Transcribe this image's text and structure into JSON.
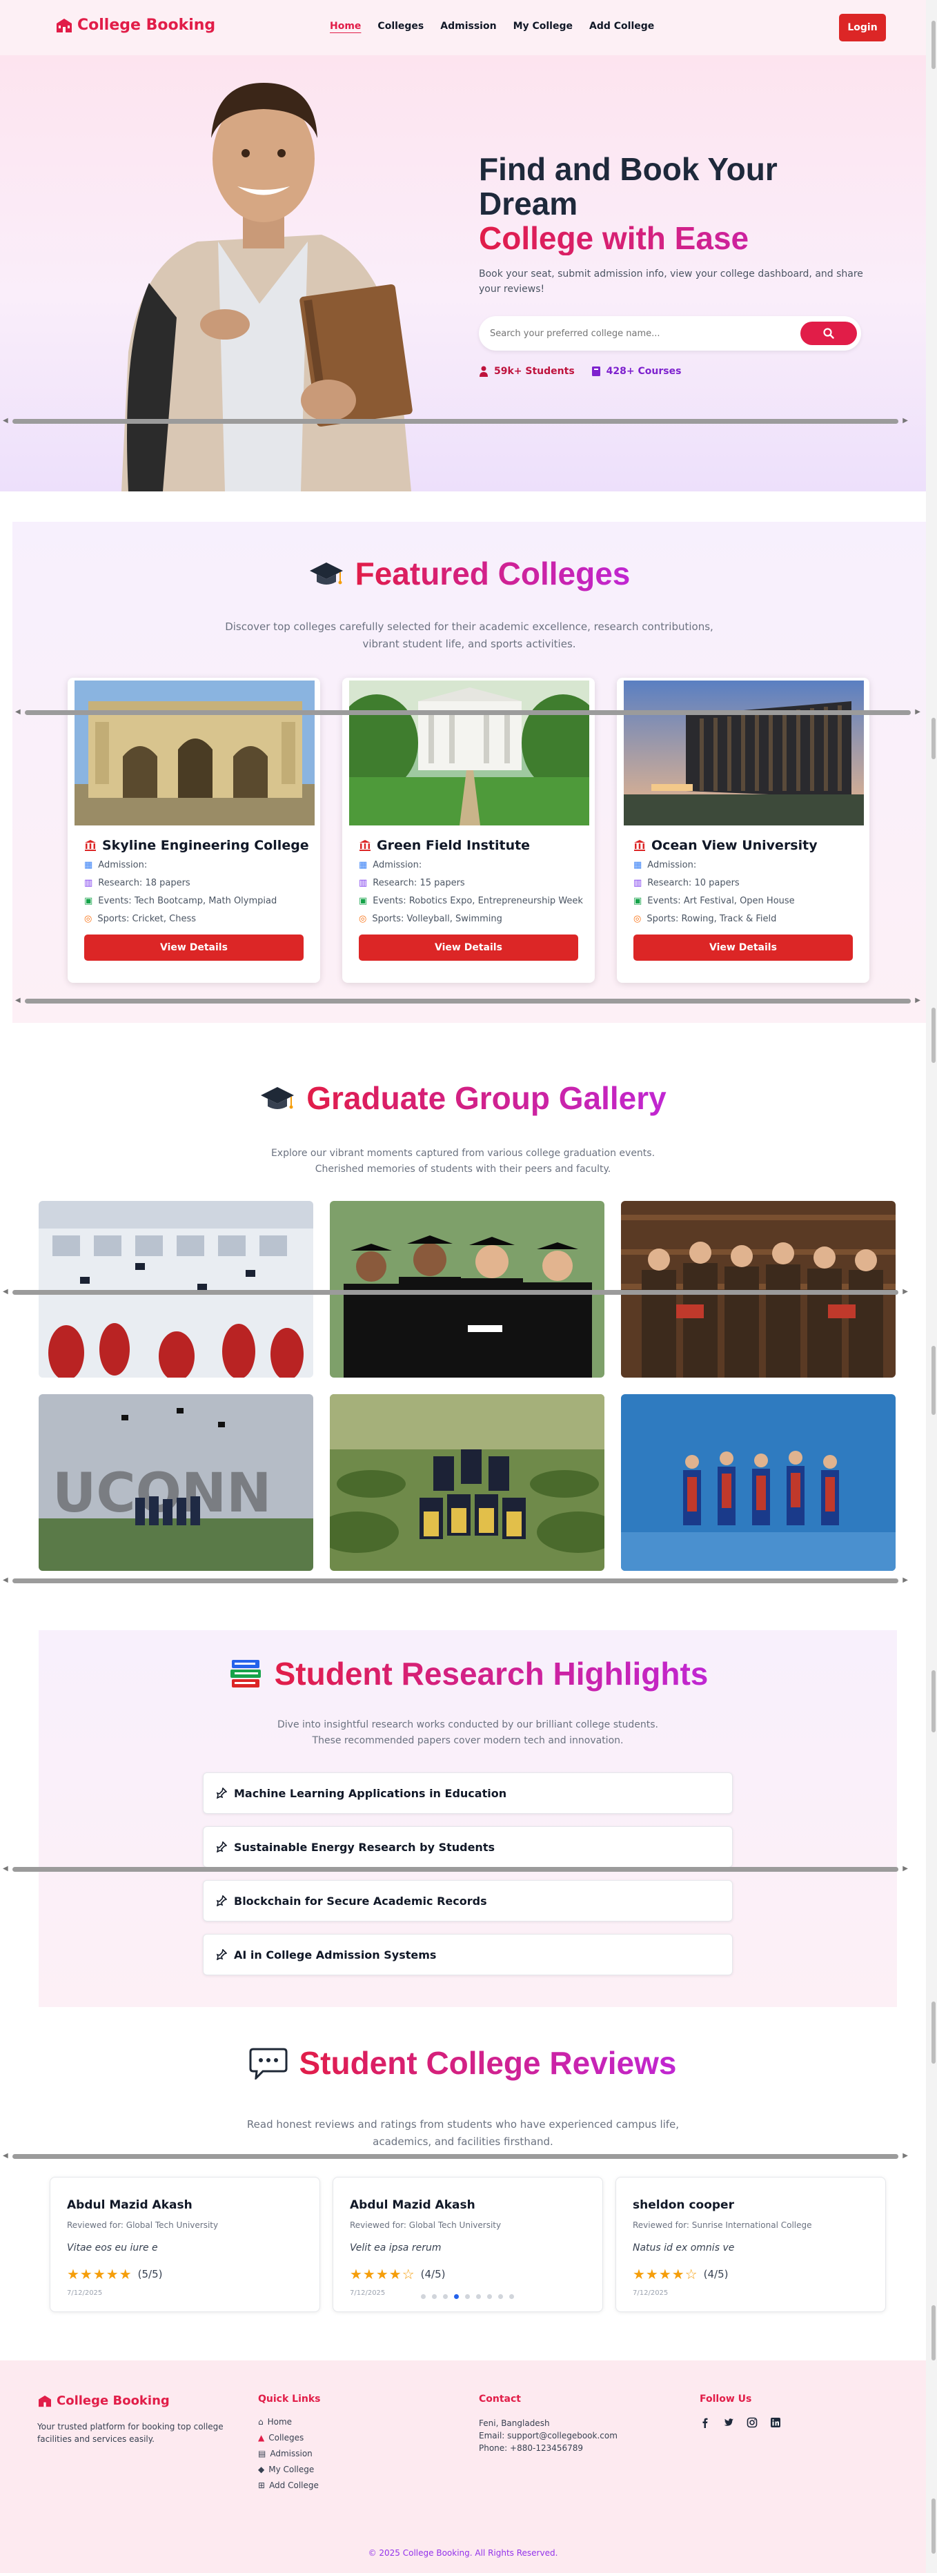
{
  "brand": {
    "name": "College Booking",
    "accent": "#e11d48",
    "accent2": "#c026d3"
  },
  "nav": {
    "links": [
      "Home",
      "Colleges",
      "Admission",
      "My College",
      "Add College"
    ],
    "active": "Home",
    "login_label": "Login"
  },
  "hero": {
    "title_line1": "Find and Book Your",
    "title_line2": "Dream",
    "title_line3": "College with Ease",
    "subtitle": "Book your seat, submit admission info, view your college dashboard, and share your reviews!",
    "search_placeholder": "Search your preferred college name...",
    "stat_students": "59k+ Students",
    "stat_courses": "428+ Courses"
  },
  "featured": {
    "title": "Featured Colleges",
    "subtitle_line1": "Discover top colleges carefully selected for their academic excellence, research contributions,",
    "subtitle_line2": "vibrant student life, and sports activities.",
    "cards": [
      {
        "name": "Skyline Engineering College",
        "admission": "Admission:",
        "research": "Research: 18 papers",
        "events": "Events: Tech Bootcamp, Math Olympiad",
        "sports": "Sports: Cricket, Chess",
        "button": "View Details"
      },
      {
        "name": "Green Field Institute",
        "admission": "Admission:",
        "research": "Research: 15 papers",
        "events": "Events: Robotics Expo, Entrepreneurship Week",
        "sports": "Sports: Volleyball, Swimming",
        "button": "View Details"
      },
      {
        "name": "Ocean View University",
        "admission": "Admission:",
        "research": "Research: 10 papers",
        "events": "Events: Art Festival, Open House",
        "sports": "Sports: Rowing, Track & Field",
        "button": "View Details"
      }
    ]
  },
  "gallery": {
    "title": "Graduate Group Gallery",
    "subtitle_line1": "Explore our vibrant moments captured from various college graduation events.",
    "subtitle_line2": "Cherished memories of students with their peers and faculty.",
    "uconn_text": "UCONN"
  },
  "research": {
    "title": "Student Research Highlights",
    "subtitle_line1": "Dive into insightful research works conducted by our brilliant college students.",
    "subtitle_line2": "These recommended papers cover modern tech and innovation.",
    "items": [
      "Machine Learning Applications in Education",
      "Sustainable Energy Research by Students",
      "Blockchain for Secure Academic Records",
      "AI in College Admission Systems"
    ]
  },
  "reviews": {
    "title": "Student College Reviews",
    "subtitle_line1": "Read honest reviews and ratings from students who have experienced campus life,",
    "subtitle_line2": "academics, and facilities firsthand.",
    "cards": [
      {
        "name": "Abdul Mazid Akash",
        "reviewed_for": "Reviewed for: Global Tech University",
        "text": "Vitae eos eu iure e",
        "stars": "★★★★★",
        "score": "(5/5)",
        "date": "7/12/2025",
        "rating": 5
      },
      {
        "name": "Abdul Mazid Akash",
        "reviewed_for": "Reviewed for: Global Tech University",
        "text": "Velit ea ipsa rerum",
        "stars": "★★★★☆",
        "score": "(4/5)",
        "date": "7/12/2025",
        "rating": 4
      },
      {
        "name": "sheldon cooper",
        "reviewed_for": "Reviewed for: Sunrise International College",
        "text": "Natus id ex omnis ve",
        "stars": "★★★★☆",
        "score": "(4/5)",
        "date": "7/12/2025",
        "rating": 4
      }
    ],
    "carousel_pages": 9,
    "carousel_active_index": 3
  },
  "footer": {
    "brand": "College Booking",
    "tagline": "Your trusted platform for booking top college facilities and services easily.",
    "quick_links_title": "Quick Links",
    "quick_links": [
      "Home",
      "Colleges",
      "Admission",
      "My College",
      "Add College"
    ],
    "contact_title": "Contact",
    "contact_location": "Feni, Bangladesh",
    "contact_email": "Email: support@collegebook.com",
    "contact_phone": "Phone: +880-123456789",
    "follow_title": "Follow Us",
    "socials": [
      "facebook-icon",
      "twitter-icon",
      "instagram-icon",
      "linkedin-icon"
    ],
    "copyright": "© 2025 College Booking. All Rights Reserved."
  }
}
